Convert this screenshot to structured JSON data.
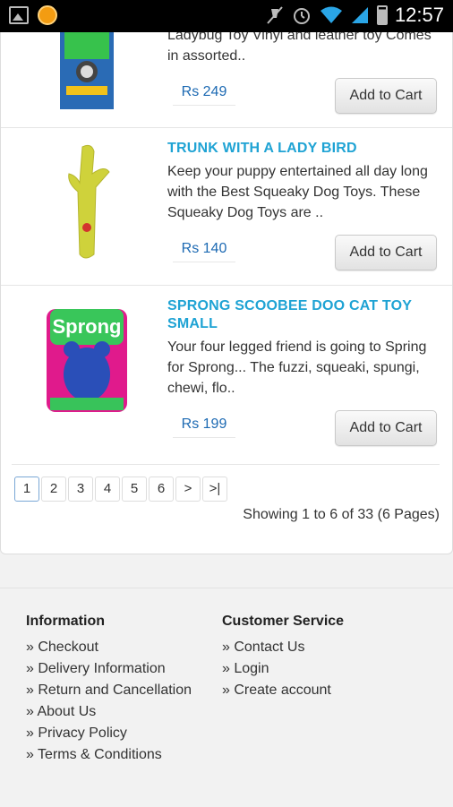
{
  "status_bar": {
    "time": "12:57"
  },
  "products": [
    {
      "desc": "Ladybug Toy Vinyl and leather toy Comes in assorted..",
      "price": "Rs 249",
      "cart_label": "Add to Cart"
    },
    {
      "title": "TRUNK WITH A LADY BIRD",
      "desc": "Keep your puppy entertained all day long with the Best Squeaky Dog Toys. These Squeaky Dog Toys are ..",
      "price": "Rs 140",
      "cart_label": "Add to Cart"
    },
    {
      "title": "SPRONG SCOOBEE DOO CAT TOY SMALL",
      "desc": "Your four legged friend is going to Spring for Sprong... The fuzzi, squeaki, spungi, chewi, flo..",
      "price": "Rs 199",
      "cart_label": "Add to Cart",
      "thumb_text": "Sprong"
    }
  ],
  "pagination": {
    "pages": [
      "1",
      "2",
      "3",
      "4",
      "5",
      "6",
      ">",
      ">|"
    ],
    "current": "1",
    "showing": "Showing 1 to 6 of 33 (6 Pages)"
  },
  "footer": {
    "information": {
      "heading": "Information",
      "links": [
        "» Checkout",
        "» Delivery Information",
        "» Return and Cancellation",
        "» About Us",
        "» Privacy Policy",
        "» Terms & Conditions"
      ]
    },
    "customer_service": {
      "heading": "Customer Service",
      "links": [
        "» Contact Us",
        "» Login",
        "» Create account"
      ]
    }
  },
  "colors": {
    "title_blue": "#1fa3d4",
    "price_blue": "#1d6ab3",
    "status_bar": "#000000",
    "wifi_signal": "#2aa5e6"
  }
}
